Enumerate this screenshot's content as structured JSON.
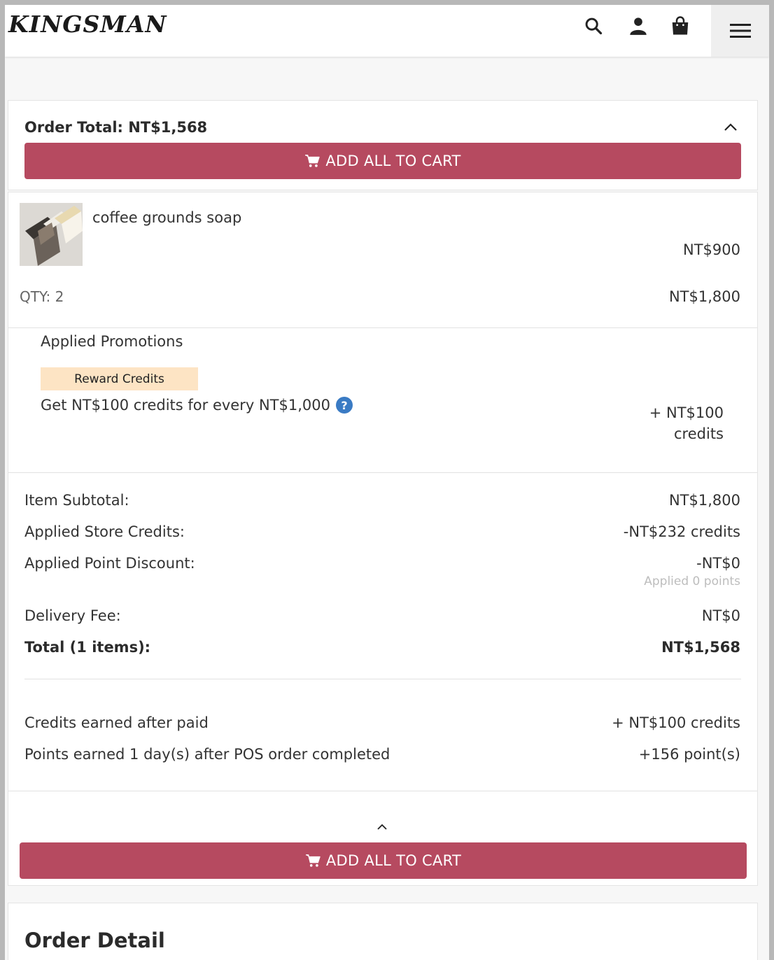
{
  "header": {
    "logo": "KINGSMAN",
    "icons": [
      "search-icon",
      "user-icon",
      "shopping-bag-icon",
      "hamburger-menu-icon"
    ]
  },
  "summary": {
    "order_total": "Order Total: NT$1,568",
    "add_all_label": "ADD ALL TO CART"
  },
  "item": {
    "name": "coffee grounds soap",
    "unit_price": "NT$900",
    "qty": "QTY: 2",
    "line_total": "NT$1,800"
  },
  "promotions": {
    "title": "Applied Promotions",
    "badge": "Reward Credits",
    "description": "Get NT$100 credits for every NT$1,000",
    "help_glyph": "?",
    "earned_line1": "+ NT$100",
    "earned_line2": "credits"
  },
  "totals": {
    "subtotal_label": "Item Subtotal:",
    "subtotal_value": "NT$1,800",
    "store_credits_label": "Applied Store Credits:",
    "store_credits_value": "-NT$232 credits",
    "point_discount_label": "Applied Point Discount:",
    "point_discount_value": "-NT$0",
    "point_discount_note": "Applied 0 points",
    "delivery_label": "Delivery Fee:",
    "delivery_value": "NT$0",
    "total_label": "Total (1 items):",
    "total_value": "NT$1,568"
  },
  "earnings": {
    "credits_label": "Credits earned after paid",
    "credits_value": "+ NT$100 credits",
    "points_label": "Points earned 1 day(s) after POS order completed",
    "points_value": "+156 point(s)"
  },
  "footer": {
    "add_all_label": "ADD ALL TO CART"
  },
  "order_detail": {
    "title": "Order Detail"
  },
  "colors": {
    "accent": "#b64a60",
    "badge_bg": "#fde4c4",
    "help_icon": "#3a7bc4"
  }
}
